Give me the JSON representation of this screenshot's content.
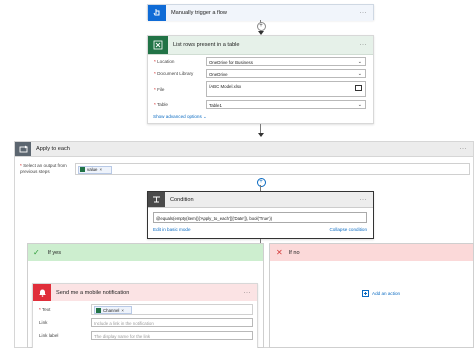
{
  "trigger": {
    "title": "Manually trigger a flow",
    "more": "···"
  },
  "list_rows": {
    "title": "List rows present in a table",
    "more": "···",
    "fields": [
      {
        "label": "Location",
        "value": "OneDrive for Business"
      },
      {
        "label": "Document Library",
        "value": "OneDrive"
      },
      {
        "label": "File",
        "value": "/ABC Model.xlsx"
      },
      {
        "label": "Table",
        "value": "Table1"
      }
    ],
    "advanced_link": "Show advanced options"
  },
  "apply_each": {
    "title": "Apply to each",
    "more": "···",
    "select_label": "Select an output from previous steps",
    "token": "value",
    "token_remove": "×"
  },
  "condition": {
    "title": "Condition",
    "more": "···",
    "expression": "@equals(empty(item()['Apply_to_each'])['Date']), bool('True'))",
    "edit_link": "Edit in basic mode",
    "collapse_link": "Collapse condition"
  },
  "if_yes": {
    "title": "If yes"
  },
  "if_no": {
    "title": "If no",
    "add_action": "Add an action"
  },
  "notification": {
    "title": "Send me a mobile notification",
    "more": "···",
    "fields": [
      {
        "label": "Text",
        "token": "Channel",
        "token_remove": "×"
      },
      {
        "label": "Link",
        "placeholder": "Include a link in the notification"
      },
      {
        "label": "Link label",
        "placeholder": "The display name for the link"
      }
    ]
  },
  "colors": {
    "trigger_blue": "#0f6bd6",
    "excel_green": "#217346",
    "apply_gray": "#5c6670",
    "condition_dark": "#4a4a4a",
    "yes_green": "#bfe6c1",
    "no_red": "#f7d4d4",
    "notify_red": "#e02e3a"
  }
}
